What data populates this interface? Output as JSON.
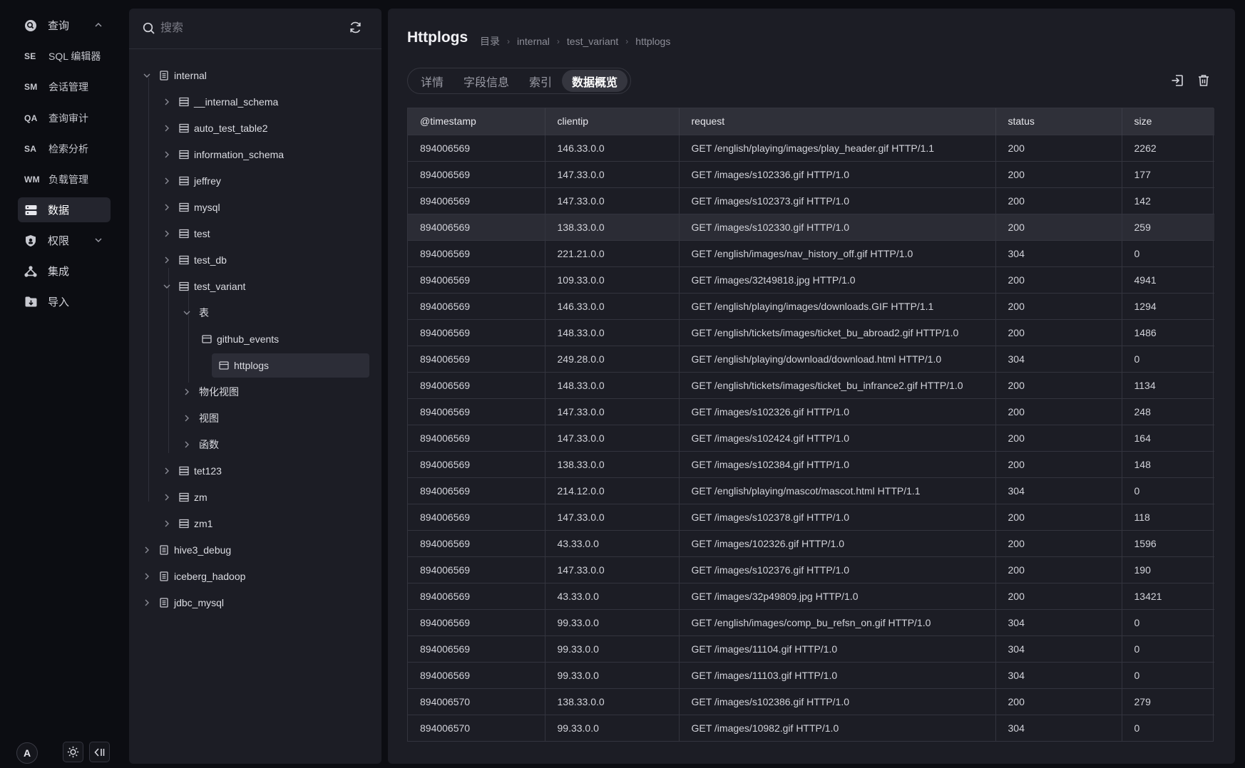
{
  "nav": {
    "items": [
      {
        "key": "query",
        "label": "查询",
        "icon": "query-icon",
        "expanded": true
      },
      {
        "key": "sql-editor",
        "abbr": "SE",
        "label": "SQL 编辑器"
      },
      {
        "key": "sessions",
        "abbr": "SM",
        "label": "会话管理"
      },
      {
        "key": "audit",
        "abbr": "QA",
        "label": "查询审计"
      },
      {
        "key": "search-analysis",
        "abbr": "SA",
        "label": "检索分析"
      },
      {
        "key": "workload",
        "abbr": "WM",
        "label": "负载管理"
      },
      {
        "key": "data",
        "label": "数据",
        "icon": "database-icon",
        "active": true
      },
      {
        "key": "permissions",
        "label": "权限",
        "icon": "shield-icon"
      },
      {
        "key": "integration",
        "label": "集成",
        "icon": "integration-icon"
      },
      {
        "key": "import",
        "label": "导入",
        "icon": "folder-import-icon"
      }
    ],
    "avatar_letter": "A"
  },
  "tree": {
    "search_placeholder": "搜索",
    "nodes": [
      {
        "label": "internal",
        "type": "catalog",
        "expanded": true
      },
      {
        "label": "__internal_schema",
        "type": "database"
      },
      {
        "label": "auto_test_table2",
        "type": "database"
      },
      {
        "label": "information_schema",
        "type": "database"
      },
      {
        "label": "jeffrey",
        "type": "database"
      },
      {
        "label": "mysql",
        "type": "database"
      },
      {
        "label": "test",
        "type": "database"
      },
      {
        "label": "test_db",
        "type": "database"
      },
      {
        "label": "test_variant",
        "type": "database",
        "expanded": true
      },
      {
        "label": "表",
        "type": "group",
        "expanded": true
      },
      {
        "label": "github_events",
        "type": "table"
      },
      {
        "label": "httplogs",
        "type": "table",
        "selected": true
      },
      {
        "label": "物化视图",
        "type": "group"
      },
      {
        "label": "视图",
        "type": "group"
      },
      {
        "label": "函数",
        "type": "group"
      },
      {
        "label": "tet123",
        "type": "database"
      },
      {
        "label": "zm",
        "type": "database"
      },
      {
        "label": "zm1",
        "type": "database"
      },
      {
        "label": "hive3_debug",
        "type": "catalog"
      },
      {
        "label": "iceberg_hadoop",
        "type": "catalog"
      },
      {
        "label": "jdbc_mysql",
        "type": "catalog"
      }
    ]
  },
  "main": {
    "title": "Httplogs",
    "breadcrumb": [
      "目录",
      "internal",
      "test_variant",
      "httplogs"
    ],
    "tabs": [
      {
        "label": "详情"
      },
      {
        "label": "字段信息"
      },
      {
        "label": "索引"
      },
      {
        "label": "数据概览",
        "active": true
      }
    ],
    "table": {
      "columns": [
        "@timestamp",
        "clientip",
        "request",
        "status",
        "size"
      ],
      "rows": [
        [
          "894006569",
          "146.33.0.0",
          "GET /english/playing/images/play_header.gif HTTP/1.1",
          "200",
          "2262"
        ],
        [
          "894006569",
          "147.33.0.0",
          "GET /images/s102336.gif HTTP/1.0",
          "200",
          "177"
        ],
        [
          "894006569",
          "147.33.0.0",
          "GET /images/s102373.gif HTTP/1.0",
          "200",
          "142"
        ],
        [
          "894006569",
          "138.33.0.0",
          "GET /images/s102330.gif HTTP/1.0",
          "200",
          "259"
        ],
        [
          "894006569",
          "221.21.0.0",
          "GET /english/images/nav_history_off.gif HTTP/1.0",
          "304",
          "0"
        ],
        [
          "894006569",
          "109.33.0.0",
          "GET /images/32t49818.jpg HTTP/1.0",
          "200",
          "4941"
        ],
        [
          "894006569",
          "146.33.0.0",
          "GET /english/playing/images/downloads.GIF HTTP/1.1",
          "200",
          "1294"
        ],
        [
          "894006569",
          "148.33.0.0",
          "GET /english/tickets/images/ticket_bu_abroad2.gif HTTP/1.0",
          "200",
          "1486"
        ],
        [
          "894006569",
          "249.28.0.0",
          "GET /english/playing/download/download.html HTTP/1.0",
          "304",
          "0"
        ],
        [
          "894006569",
          "148.33.0.0",
          "GET /english/tickets/images/ticket_bu_infrance2.gif HTTP/1.0",
          "200",
          "1134"
        ],
        [
          "894006569",
          "147.33.0.0",
          "GET /images/s102326.gif HTTP/1.0",
          "200",
          "248"
        ],
        [
          "894006569",
          "147.33.0.0",
          "GET /images/s102424.gif HTTP/1.0",
          "200",
          "164"
        ],
        [
          "894006569",
          "138.33.0.0",
          "GET /images/s102384.gif HTTP/1.0",
          "200",
          "148"
        ],
        [
          "894006569",
          "214.12.0.0",
          "GET /english/playing/mascot/mascot.html HTTP/1.1",
          "304",
          "0"
        ],
        [
          "894006569",
          "147.33.0.0",
          "GET /images/s102378.gif HTTP/1.0",
          "200",
          "118"
        ],
        [
          "894006569",
          "43.33.0.0",
          "GET /images/102326.gif HTTP/1.0",
          "200",
          "1596"
        ],
        [
          "894006569",
          "147.33.0.0",
          "GET /images/s102376.gif HTTP/1.0",
          "200",
          "190"
        ],
        [
          "894006569",
          "43.33.0.0",
          "GET /images/32p49809.jpg HTTP/1.0",
          "200",
          "13421"
        ],
        [
          "894006569",
          "99.33.0.0",
          "GET /english/images/comp_bu_refsn_on.gif HTTP/1.0",
          "304",
          "0"
        ],
        [
          "894006569",
          "99.33.0.0",
          "GET /images/11104.gif HTTP/1.0",
          "304",
          "0"
        ],
        [
          "894006569",
          "99.33.0.0",
          "GET /images/11103.gif HTTP/1.0",
          "304",
          "0"
        ],
        [
          "894006570",
          "138.33.0.0",
          "GET /images/s102386.gif HTTP/1.0",
          "200",
          "279"
        ],
        [
          "894006570",
          "99.33.0.0",
          "GET /images/10982.gif HTTP/1.0",
          "304",
          "0"
        ]
      ]
    }
  }
}
